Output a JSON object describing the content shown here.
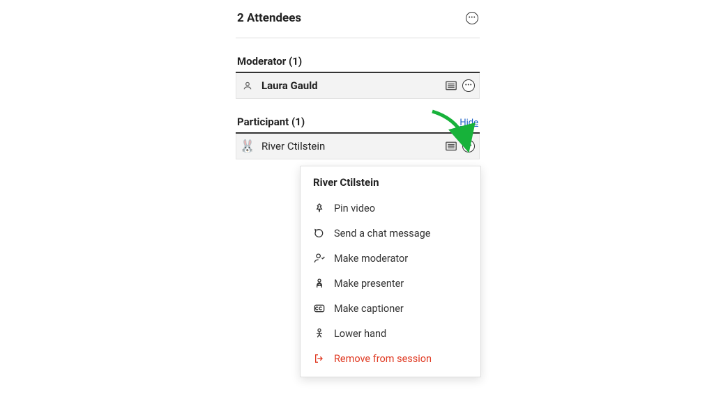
{
  "header": {
    "title": "2 Attendees"
  },
  "sections": {
    "moderator": {
      "title": "Moderator (1)",
      "rows": [
        {
          "name": "Laura Gauld"
        }
      ]
    },
    "participant": {
      "title": "Participant (1)",
      "hide_label": "Hide",
      "rows": [
        {
          "name": "River Ctilstein"
        }
      ]
    }
  },
  "menu": {
    "title": "River Ctilstein",
    "items": {
      "pin": "Pin video",
      "chat": "Send a chat message",
      "moderator": "Make moderator",
      "presenter": "Make presenter",
      "captioner": "Make captioner",
      "lowerhand": "Lower hand",
      "remove": "Remove from session"
    }
  }
}
